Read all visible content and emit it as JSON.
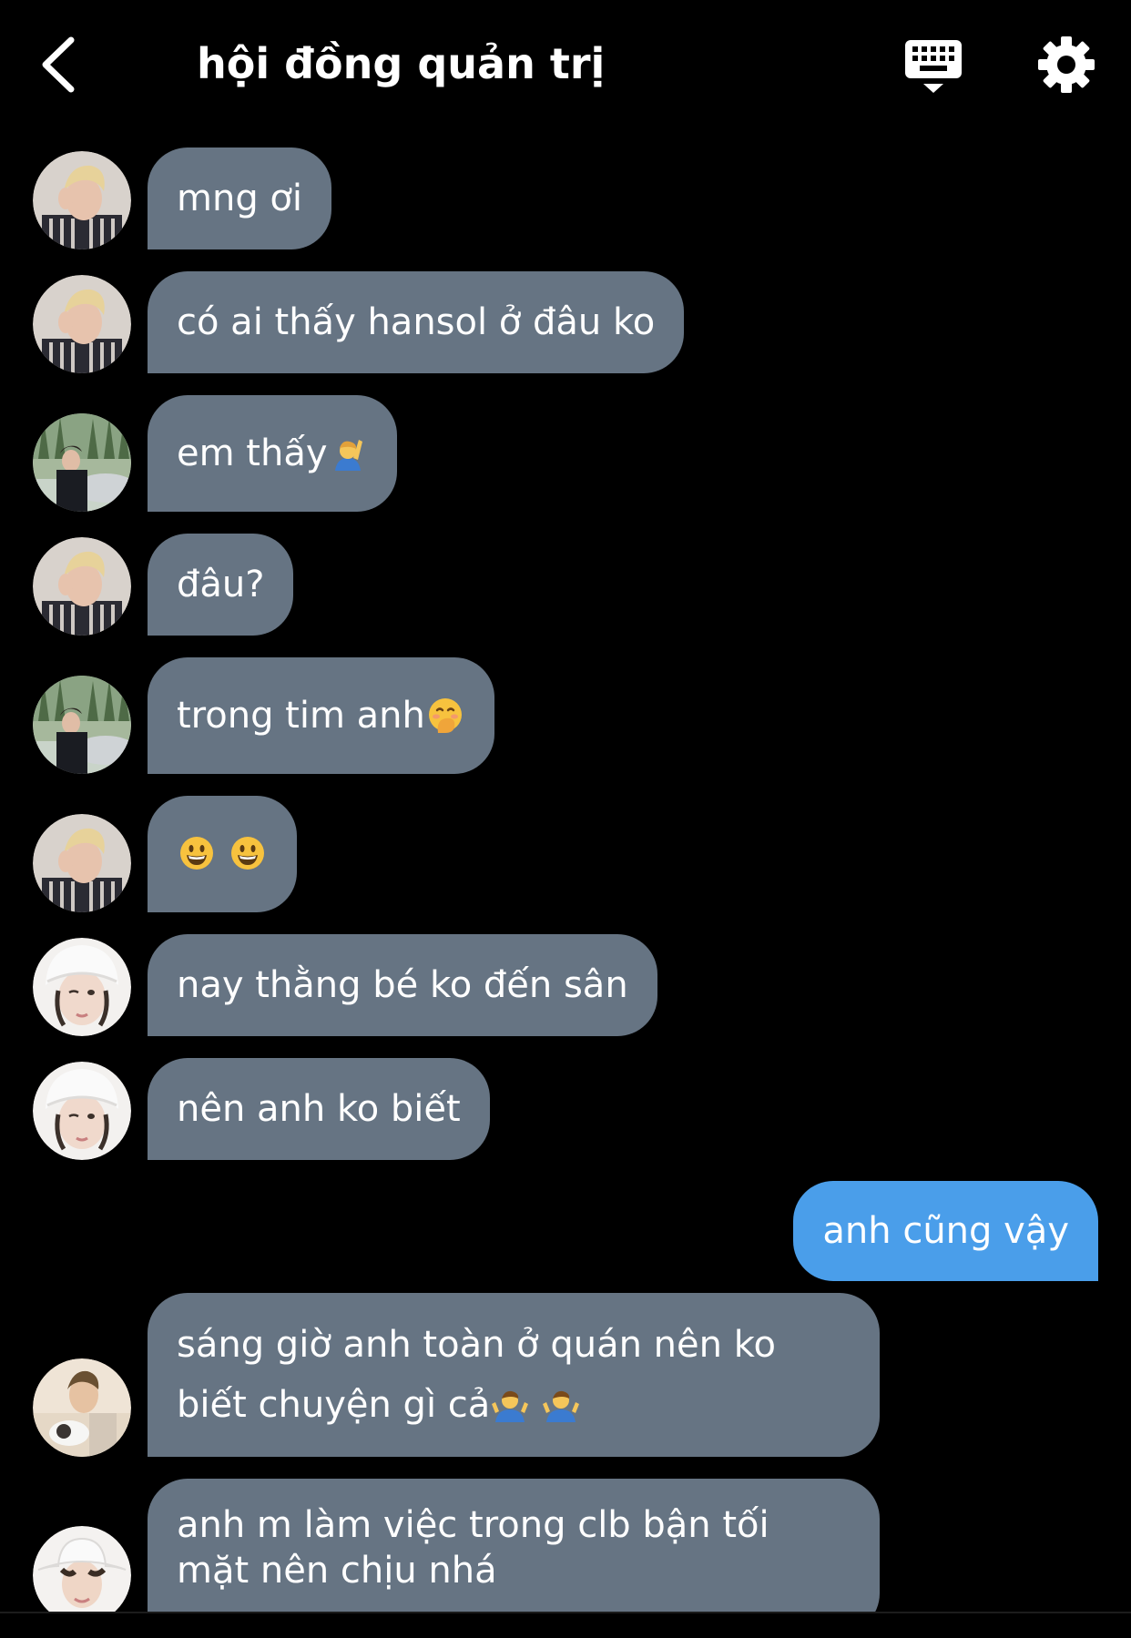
{
  "header": {
    "title": "hội đồng quản trị",
    "back_icon": "chevron-left-icon",
    "keyboard_icon": "keyboard-icon",
    "settings_icon": "gear-icon"
  },
  "colors": {
    "background": "#000000",
    "incoming_bubble": "#667483",
    "outgoing_bubble": "#4a9eea",
    "text": "#ffffff"
  },
  "messages": [
    {
      "sender": "blond",
      "text": "mng ơi",
      "emoji": []
    },
    {
      "sender": "blond",
      "text": "có ai thấy hansol ở đâu ko",
      "emoji": []
    },
    {
      "sender": "car",
      "text": "em thấy",
      "emoji": [
        "person-raising-hand-emoji"
      ]
    },
    {
      "sender": "blond",
      "text": "đâu?",
      "emoji": []
    },
    {
      "sender": "car",
      "text": "trong tim anh",
      "emoji": [
        "face-with-hand-over-mouth-emoji"
      ]
    },
    {
      "sender": "blond",
      "text": "",
      "emoji": [
        "grinning-face-emoji",
        "grinning-face-emoji"
      ]
    },
    {
      "sender": "beanie",
      "text": "nay thằng bé ko đến sân",
      "emoji": []
    },
    {
      "sender": "beanie",
      "text": "nên anh ko biết",
      "emoji": []
    },
    {
      "sender": "me",
      "text": "anh cũng vậy",
      "emoji": []
    },
    {
      "sender": "cat",
      "text": "sáng giờ anh toàn ở quán nên ko biết chuyện gì cả",
      "emoji": [
        "man-shrugging-emoji",
        "man-shrugging-emoji"
      ]
    },
    {
      "sender": "bucket-hat",
      "text": "anh m làm việc trong clb bận tối mặt nên chịu nhá",
      "emoji": []
    }
  ]
}
